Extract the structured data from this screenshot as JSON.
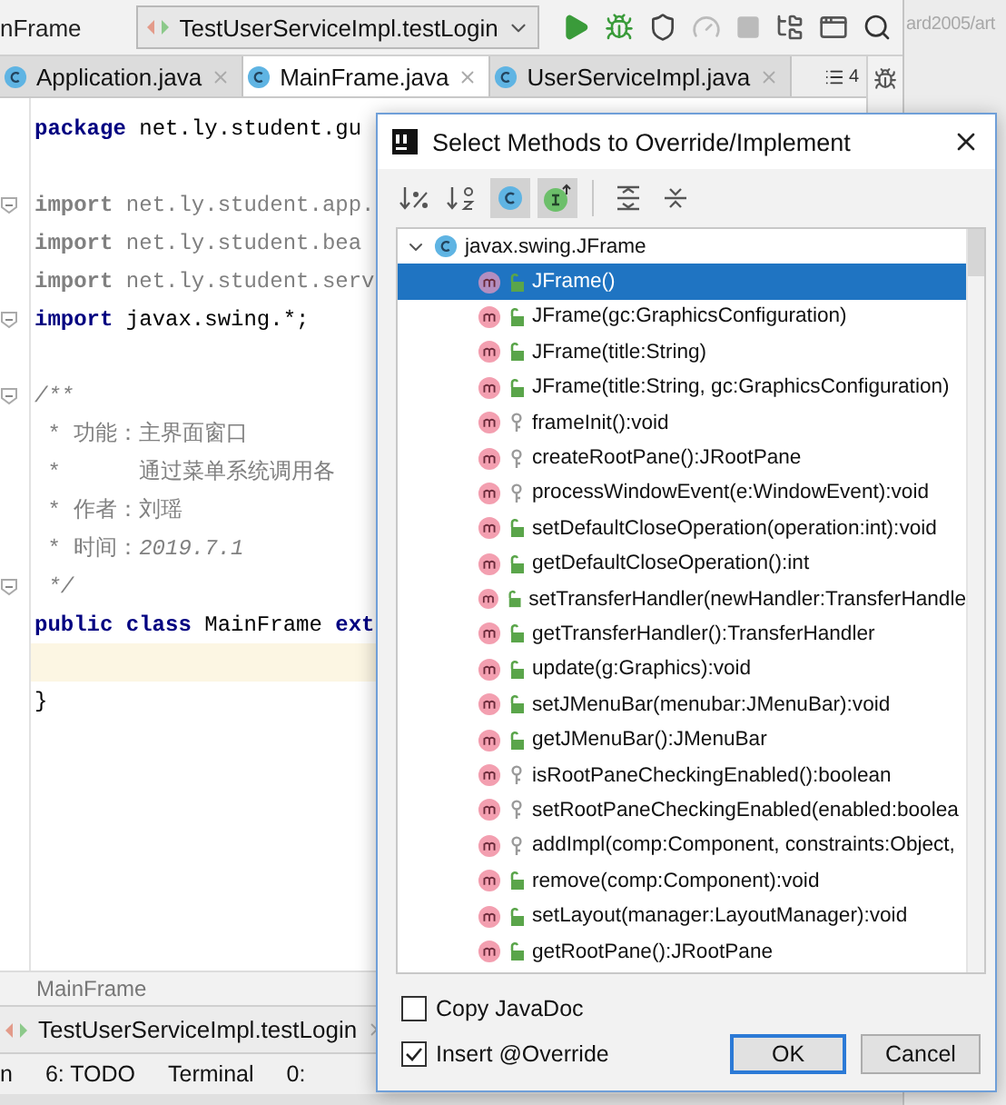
{
  "toolbar": {
    "breadcrumb": "nFrame",
    "run_config": "TestUserServiceImpl.testLogin"
  },
  "background_text": "ard2005/art",
  "tabs": [
    {
      "label": "Application.java",
      "selected": false
    },
    {
      "label": "MainFrame.java",
      "selected": true
    },
    {
      "label": "UserServiceImpl.java",
      "selected": false
    }
  ],
  "tab_count": "4",
  "code_lines": [
    {
      "kind": "code",
      "fold": false,
      "current": false,
      "segments": [
        {
          "kind": "keyword",
          "text": "package"
        },
        {
          "kind": "plain",
          "text": " net.ly.student.gu"
        }
      ]
    },
    {
      "kind": "blank",
      "fold": false,
      "current": false
    },
    {
      "kind": "code",
      "fold": true,
      "current": false,
      "segments": [
        {
          "kind": "unused-keyword",
          "text": "import"
        },
        {
          "kind": "unused",
          "text": " net.ly.student.app."
        }
      ]
    },
    {
      "kind": "code",
      "fold": false,
      "current": false,
      "segments": [
        {
          "kind": "unused-keyword",
          "text": "import"
        },
        {
          "kind": "unused",
          "text": " net.ly.student.bea"
        }
      ]
    },
    {
      "kind": "code",
      "fold": false,
      "current": false,
      "segments": [
        {
          "kind": "unused-keyword",
          "text": "import"
        },
        {
          "kind": "unused",
          "text": " net.ly.student.serv"
        }
      ]
    },
    {
      "kind": "code",
      "fold": true,
      "current": false,
      "segments": [
        {
          "kind": "keyword",
          "text": "import"
        },
        {
          "kind": "plain",
          "text": " javax.swing.*;"
        }
      ]
    },
    {
      "kind": "blank",
      "fold": false,
      "current": false
    },
    {
      "kind": "code",
      "fold": true,
      "current": false,
      "segments": [
        {
          "kind": "comment",
          "text": "/**"
        }
      ]
    },
    {
      "kind": "code",
      "fold": false,
      "current": false,
      "segments": [
        {
          "kind": "doc",
          "text": " * 功能：主界面窗口"
        }
      ]
    },
    {
      "kind": "code",
      "fold": false,
      "current": false,
      "segments": [
        {
          "kind": "doc",
          "text": " *      通过菜单系统调用各"
        }
      ]
    },
    {
      "kind": "code",
      "fold": false,
      "current": false,
      "segments": [
        {
          "kind": "doc",
          "text": " * 作者：刘瑶"
        }
      ]
    },
    {
      "kind": "code",
      "fold": false,
      "current": false,
      "segments": [
        {
          "kind": "doc",
          "text": " * 时间："
        },
        {
          "kind": "comment",
          "text": "2019.7.1"
        }
      ]
    },
    {
      "kind": "code",
      "fold": true,
      "current": false,
      "segments": [
        {
          "kind": "comment",
          "text": " */"
        }
      ]
    },
    {
      "kind": "code",
      "fold": false,
      "current": false,
      "segments": [
        {
          "kind": "keyword",
          "text": "public class"
        },
        {
          "kind": "plain",
          "text": " MainFrame "
        },
        {
          "kind": "keyword",
          "text": "ext"
        }
      ]
    },
    {
      "kind": "blank",
      "fold": false,
      "current": true
    },
    {
      "kind": "code",
      "fold": false,
      "current": false,
      "segments": [
        {
          "kind": "plain",
          "text": "}"
        }
      ]
    }
  ],
  "breadcrumb": "MainFrame",
  "run_tab": "TestUserServiceImpl.testLogin",
  "tool_windows": [
    "n",
    "6: TODO",
    "Terminal",
    "0:"
  ],
  "dialog": {
    "title": "Select Methods to Override/Implement",
    "toolbar": [
      {
        "kind": "sort-visibility",
        "on": false
      },
      {
        "kind": "sort-alpha",
        "on": false
      },
      {
        "kind": "show-classes",
        "on": true
      },
      {
        "kind": "show-interfaces",
        "on": true
      },
      {
        "kind": "expand-all",
        "on": false
      },
      {
        "kind": "collapse-all",
        "on": false
      }
    ],
    "tree": {
      "label": "javax.swing.JFrame",
      "expanded": true,
      "children": [
        {
          "label": "JFrame()",
          "public": true,
          "selected": true
        },
        {
          "label": "JFrame(gc:GraphicsConfiguration)",
          "public": true,
          "selected": false
        },
        {
          "label": "JFrame(title:String)",
          "public": true,
          "selected": false
        },
        {
          "label": "JFrame(title:String, gc:GraphicsConfiguration)",
          "public": true,
          "selected": false
        },
        {
          "label": "frameInit():void",
          "public": false,
          "selected": false
        },
        {
          "label": "createRootPane():JRootPane",
          "public": false,
          "selected": false
        },
        {
          "label": "processWindowEvent(e:WindowEvent):void",
          "public": false,
          "selected": false
        },
        {
          "label": "setDefaultCloseOperation(operation:int):void",
          "public": true,
          "selected": false
        },
        {
          "label": "getDefaultCloseOperation():int",
          "public": true,
          "selected": false
        },
        {
          "label": "setTransferHandler(newHandler:TransferHandle",
          "public": true,
          "selected": false
        },
        {
          "label": "getTransferHandler():TransferHandler",
          "public": true,
          "selected": false
        },
        {
          "label": "update(g:Graphics):void",
          "public": true,
          "selected": false
        },
        {
          "label": "setJMenuBar(menubar:JMenuBar):void",
          "public": true,
          "selected": false
        },
        {
          "label": "getJMenuBar():JMenuBar",
          "public": true,
          "selected": false
        },
        {
          "label": "isRootPaneCheckingEnabled():boolean",
          "public": false,
          "selected": false
        },
        {
          "label": "setRootPaneCheckingEnabled(enabled:boolea",
          "public": false,
          "selected": false
        },
        {
          "label": "addImpl(comp:Component, constraints:Object,",
          "public": false,
          "selected": false
        },
        {
          "label": "remove(comp:Component):void",
          "public": true,
          "selected": false
        },
        {
          "label": "setLayout(manager:LayoutManager):void",
          "public": true,
          "selected": false
        },
        {
          "label": "getRootPane():JRootPane",
          "public": true,
          "selected": false
        }
      ]
    },
    "options": [
      {
        "label": "Copy JavaDoc",
        "checked": false
      },
      {
        "label": "Insert @Override",
        "checked": true
      }
    ],
    "buttons": [
      {
        "label": "OK",
        "default": true
      },
      {
        "label": "Cancel",
        "default": false
      }
    ]
  }
}
